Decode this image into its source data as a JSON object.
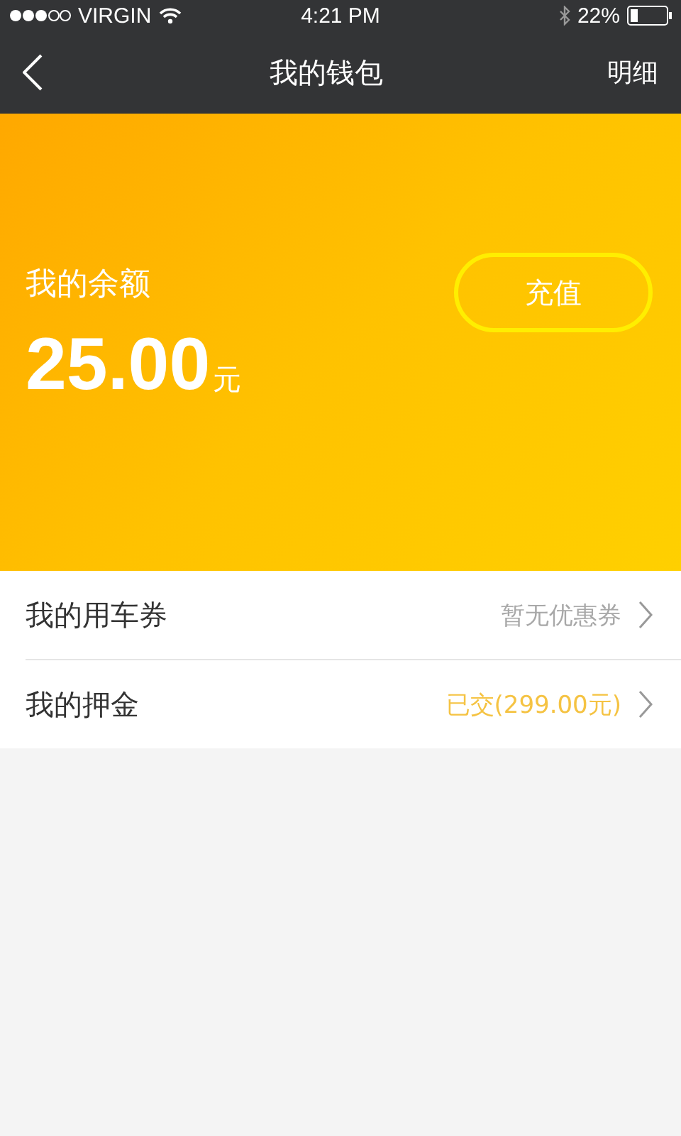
{
  "status_bar": {
    "carrier": "VIRGIN",
    "time": "4:21 PM",
    "battery": "22%"
  },
  "nav": {
    "title": "我的钱包",
    "action": "明细"
  },
  "balance": {
    "label": "我的余额",
    "amount": "25.00",
    "unit": "元",
    "button": "充值"
  },
  "rows": [
    {
      "label": "我的用车券",
      "value": "暂无优惠券",
      "color": "#a8a8a8"
    },
    {
      "label": "我的押金",
      "value": "已交(299.00元)",
      "color": "#f5c343"
    }
  ]
}
